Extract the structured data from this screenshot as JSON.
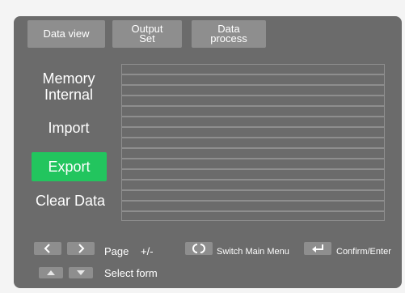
{
  "tabs": {
    "data_view": "Data view",
    "output_set": "Output\nSet",
    "data_process": "Data\nprocess"
  },
  "menu": {
    "memory_internal": "Memory\nInternal",
    "import": "Import",
    "export": "Export",
    "clear_data": "Clear Data",
    "selected": "Export"
  },
  "table": {
    "row_count": 14
  },
  "legend": {
    "page": "Page",
    "page_keys": "+/-",
    "switch_main_menu": "Switch Main Menu",
    "confirm_enter": "Confirm/Enter",
    "select_form": "Select form"
  },
  "colors": {
    "device_bg": "#6b6b6b",
    "control_gray": "#8e8e8e",
    "selected_green": "#22c55e",
    "text": "#ffffff"
  },
  "icons": {
    "left": "arrow-left-icon",
    "right": "arrow-right-icon",
    "switch": "switch-icon",
    "enter": "enter-icon",
    "up": "arrow-up-icon",
    "down": "arrow-down-icon"
  }
}
